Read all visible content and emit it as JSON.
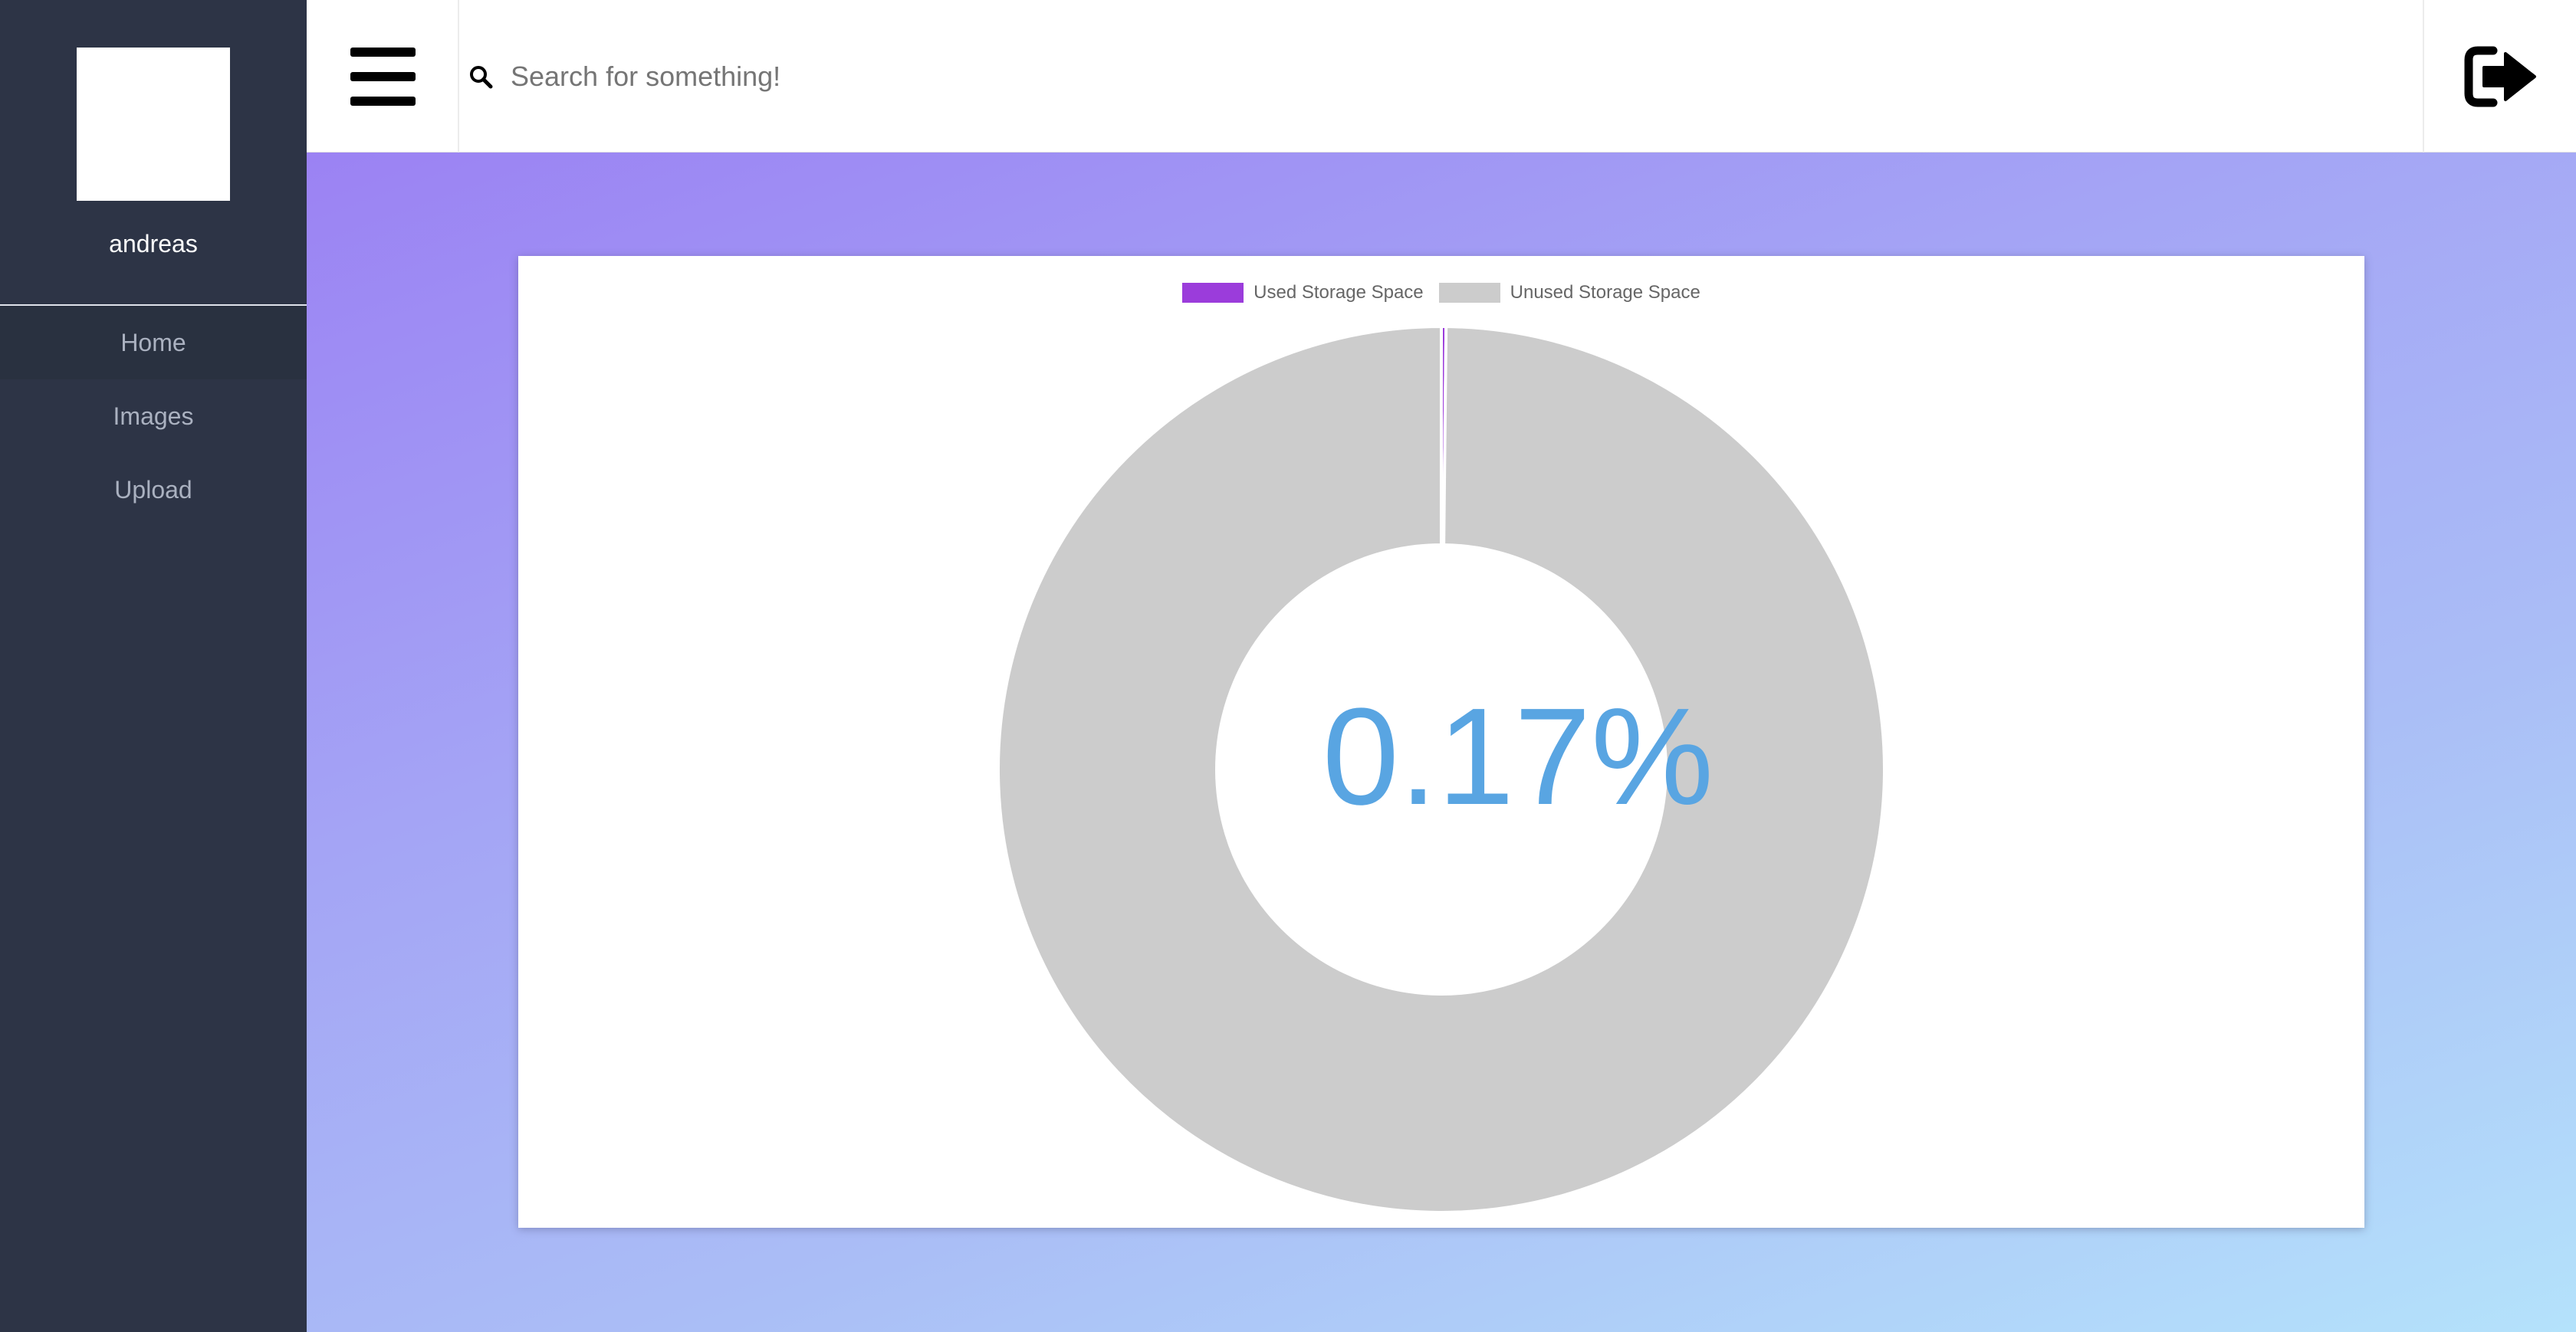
{
  "sidebar": {
    "username": "andreas",
    "nav": [
      {
        "label": "Home",
        "active": true
      },
      {
        "label": "Images",
        "active": false
      },
      {
        "label": "Upload",
        "active": false
      }
    ]
  },
  "topbar": {
    "menu_icon": "hamburger-icon",
    "search_icon": "search-icon",
    "search_placeholder": "Search for something!",
    "search_value": "",
    "logout_icon": "sign-out-icon"
  },
  "chart_data": {
    "type": "doughnut",
    "series": [
      {
        "name": "Used Storage Space",
        "value": 0.17,
        "color": "#9b3cdb"
      },
      {
        "name": "Unused Storage Space",
        "value": 99.83,
        "color": "#cccccc"
      }
    ],
    "center_text": "0.17%",
    "legend_placement": "top"
  },
  "colors": {
    "sidebar_bg": "#2d3446",
    "center_text": "#59a5e2",
    "used": "#9b3cdb",
    "unused": "#cccccc"
  }
}
